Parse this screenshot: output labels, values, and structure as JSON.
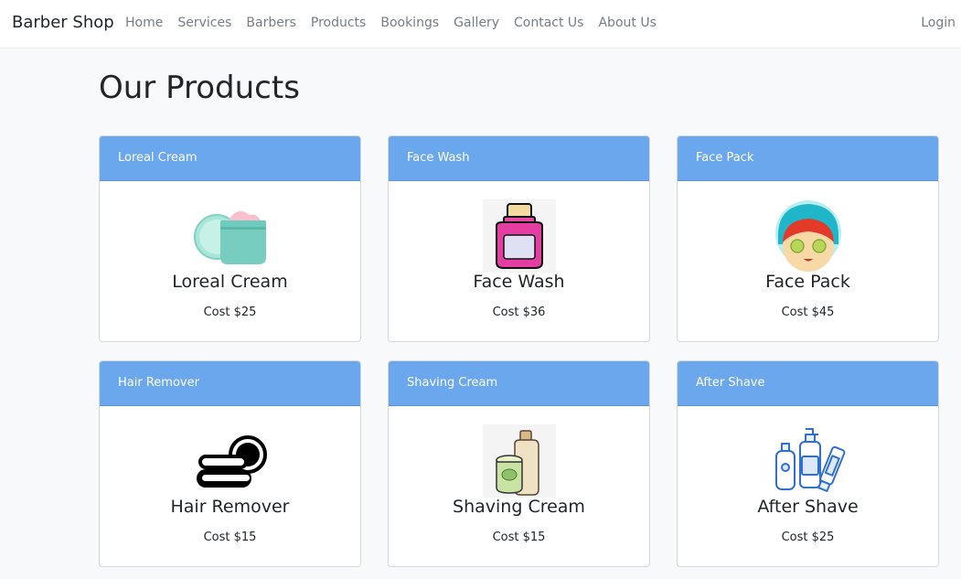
{
  "navbar": {
    "brand": "Barber Shop",
    "links": [
      "Home",
      "Services",
      "Barbers",
      "Products",
      "Bookings",
      "Gallery",
      "Contact Us",
      "About Us"
    ],
    "login": "Login"
  },
  "page": {
    "title": "Our Products"
  },
  "products": [
    {
      "header": "Loreal Cream",
      "name": "Loreal Cream",
      "cost": "Cost $25",
      "icon": "cream-jar-icon"
    },
    {
      "header": "Face Wash",
      "name": "Face Wash",
      "cost": "Cost $36",
      "icon": "face-wash-bottle-icon"
    },
    {
      "header": "Face Pack",
      "name": "Face Pack",
      "cost": "Cost $45",
      "icon": "face-pack-icon"
    },
    {
      "header": "Hair Remover",
      "name": "Hair Remover",
      "cost": "Cost $15",
      "icon": "hair-remover-icon"
    },
    {
      "header": "Shaving Cream",
      "name": "Shaving Cream",
      "cost": "Cost $15",
      "icon": "shaving-cream-icon"
    },
    {
      "header": "After Shave",
      "name": "After Shave",
      "cost": "Cost $25",
      "icon": "after-shave-icon"
    }
  ],
  "colors": {
    "card_header": "#6aa7ec",
    "background": "#f8f9fa"
  }
}
